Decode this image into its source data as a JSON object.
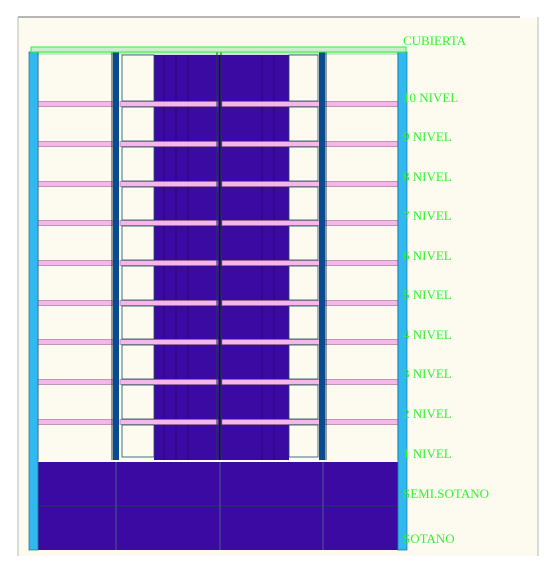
{
  "colors": {
    "canvas": "#fdfbf0",
    "line": "#6e6e6e",
    "beam": "#f7b6e9",
    "column": "#2fb9ef",
    "core": "#3b0aa2",
    "label": "#32f232",
    "roof": "#32f232",
    "outline": "#1f3f4f"
  },
  "levels": [
    {
      "label": "CUBIERTA",
      "kind": "roof"
    },
    {
      "label": "10 NIVEL",
      "kind": "floor"
    },
    {
      "label": "9 NIVEL",
      "kind": "floor"
    },
    {
      "label": "8 NIVEL",
      "kind": "floor"
    },
    {
      "label": "7 NIVEL",
      "kind": "floor"
    },
    {
      "label": "6 NIVEL",
      "kind": "floor"
    },
    {
      "label": "5 NIVEL",
      "kind": "floor"
    },
    {
      "label": "4 NIVEL",
      "kind": "floor"
    },
    {
      "label": "3 NIVEL",
      "kind": "floor"
    },
    {
      "label": "2 NIVEL",
      "kind": "floor"
    },
    {
      "label": "1 NIVEL",
      "kind": "floor"
    },
    {
      "label": "SEMI.SOTANO",
      "kind": "basement"
    },
    {
      "label": "SOTANO",
      "kind": "basement"
    }
  ]
}
